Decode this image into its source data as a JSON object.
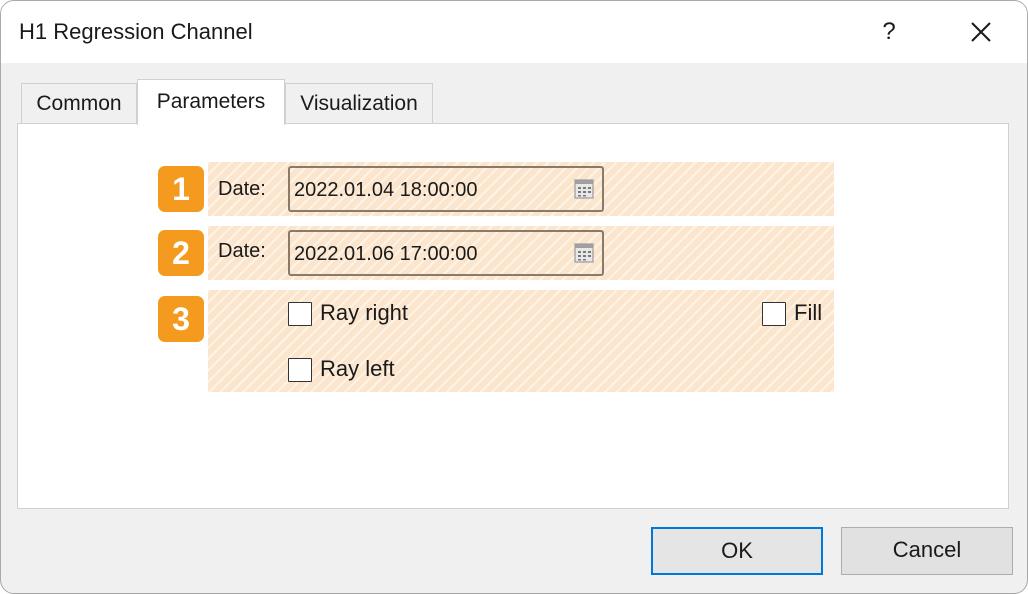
{
  "window": {
    "title": "H1 Regression Channel",
    "help_label": "?"
  },
  "tabs": [
    {
      "label": "Common",
      "active": false
    },
    {
      "label": "Parameters",
      "active": true
    },
    {
      "label": "Visualization",
      "active": false
    }
  ],
  "annotations": {
    "badge1": "1",
    "badge2": "2",
    "badge3": "3",
    "highlight_color": "#fbe5cc",
    "badge_color": "#f39a1f"
  },
  "parameters": {
    "date1": {
      "label": "Date:",
      "value": "2022.01.04 18:00:00"
    },
    "date2": {
      "label": "Date:",
      "value": "2022.01.06 17:00:00"
    },
    "ray_right": {
      "label": "Ray right",
      "checked": false
    },
    "ray_left": {
      "label": "Ray left",
      "checked": false
    },
    "fill": {
      "label": "Fill",
      "checked": false
    }
  },
  "buttons": {
    "ok": "OK",
    "cancel": "Cancel"
  },
  "icons": {
    "close": "close-icon",
    "calendar": "calendar-icon"
  }
}
